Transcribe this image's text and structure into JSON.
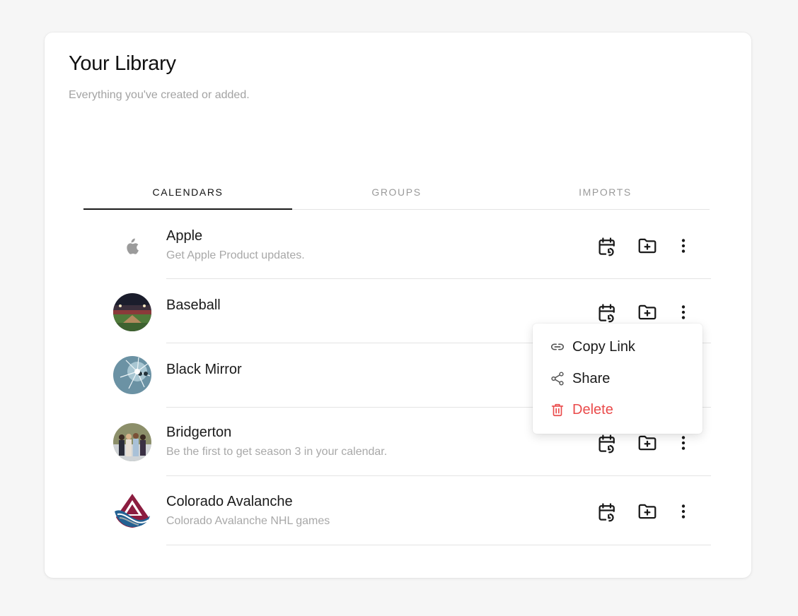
{
  "header": {
    "title": "Your Library",
    "subtitle": "Everything you've created or added."
  },
  "tabs": [
    {
      "label": "CALENDARS",
      "active": true
    },
    {
      "label": "GROUPS",
      "active": false
    },
    {
      "label": "IMPORTS",
      "active": false
    }
  ],
  "calendars": [
    {
      "title": "Apple",
      "description": "Get Apple Product updates.",
      "icon": "apple-logo-icon"
    },
    {
      "title": "Baseball",
      "description": "",
      "icon": "baseball-stadium-image"
    },
    {
      "title": "Black Mirror",
      "description": "",
      "icon": "black-mirror-image"
    },
    {
      "title": "Bridgerton",
      "description": "Be the first to get season 3 in your calendar.",
      "icon": "bridgerton-image"
    },
    {
      "title": "Colorado Avalanche",
      "description": "Colorado Avalanche NHL games",
      "icon": "avalanche-logo-image"
    }
  ],
  "actions": {
    "sync_icon": "calendar-sync-icon",
    "folder_icon": "folder-add-icon",
    "more_icon": "more-vertical-icon"
  },
  "context_menu": {
    "items": [
      {
        "label": "Copy Link",
        "icon": "link-icon"
      },
      {
        "label": "Share",
        "icon": "share-icon"
      },
      {
        "label": "Delete",
        "icon": "trash-icon"
      }
    ]
  },
  "colors": {
    "background": "#f6f6f6",
    "card": "#ffffff",
    "text_primary": "#1a1a1a",
    "text_muted": "#a8a8a8",
    "danger": "#ea4b4b",
    "divider": "#e4e4e4"
  }
}
